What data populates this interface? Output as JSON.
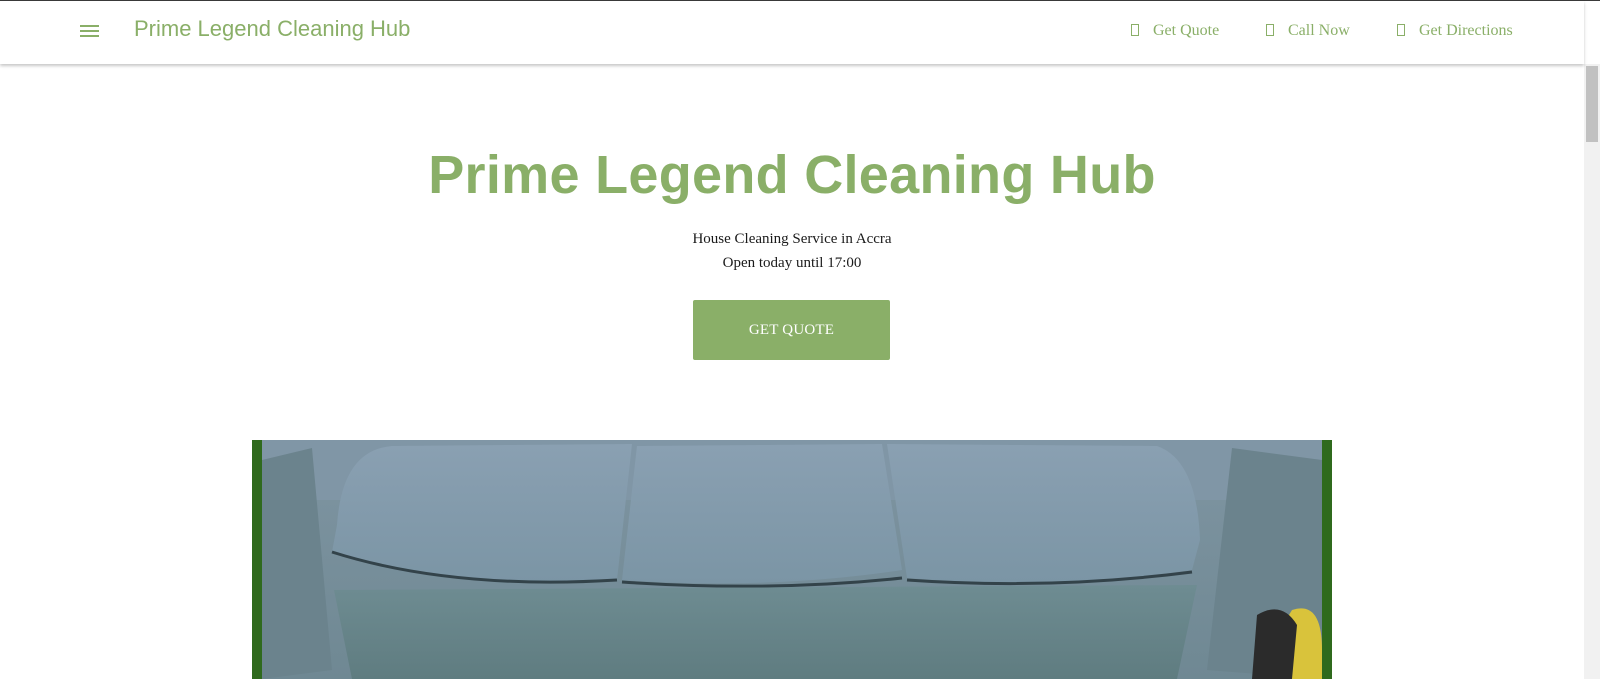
{
  "header": {
    "menu_icon": "hamburger-menu-icon",
    "brand": "Prime Legend Cleaning Hub",
    "nav": [
      {
        "label": "Get Quote",
        "icon": "quote-icon"
      },
      {
        "label": "Call Now",
        "icon": "phone-icon"
      },
      {
        "label": "Get Directions",
        "icon": "directions-icon"
      }
    ]
  },
  "hero": {
    "title": "Prime Legend Cleaning Hub",
    "subtitle": "House Cleaning Service in Accra",
    "hours": "Open today until 17:00",
    "cta_label": "GET QUOTE"
  },
  "colors": {
    "accent": "#8aaf68",
    "photo_frame": "#2f6a1d"
  }
}
